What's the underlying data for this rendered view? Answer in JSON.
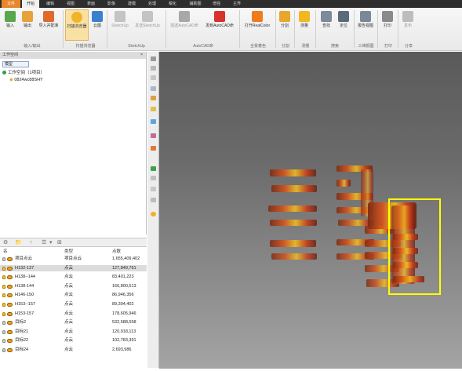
{
  "colors": {
    "menubar_bg": "#2e2e2e",
    "file_tab": "#e9852a",
    "active_bulb": "#f4c430",
    "inactive_bulb": "#cccccc",
    "highlight_box": "#ffff00"
  },
  "menu": {
    "file_tab": "文件",
    "tabs": [
      "开始",
      "编辑",
      "视图",
      "表面",
      "影像",
      "建模",
      "处理",
      "稿化",
      "辅助图",
      "增强",
      "主界"
    ],
    "active_tab": "开始"
  },
  "ribbon": {
    "buttons": [
      {
        "label": "输入",
        "icon": "import-icon"
      },
      {
        "label": "输出",
        "icon": "export-icon"
      },
      {
        "label": "导入并配准",
        "icon": "import-register-icon"
      },
      {
        "label": "扫描浏览器",
        "icon": "scan-browser-icon"
      },
      {
        "label": "云图",
        "icon": "cloud-icon"
      },
      {
        "label": "SketchUp",
        "icon": "sketchup-icon"
      },
      {
        "label": "发送SketchUp",
        "icon": "send-sketchup-icon"
      },
      {
        "label": "插送AutoCAD命",
        "icon": "cad-icon"
      },
      {
        "label": "发到AutoCAD命",
        "icon": "send-cad-icon"
      },
      {
        "label": "打开RealColor",
        "icon": "realcolor-icon"
      },
      {
        "label": "分割",
        "icon": "segment-icon"
      },
      {
        "label": "测量",
        "icon": "measure-icon"
      },
      {
        "label": "查找",
        "icon": "find-icon"
      },
      {
        "label": "定位",
        "icon": "locate-icon"
      },
      {
        "label": "报告视图",
        "icon": "report-view-icon"
      },
      {
        "label": "打印",
        "icon": "print-icon"
      },
      {
        "label": "发布",
        "icon": "publish-icon"
      }
    ],
    "groups": [
      "输入/输出",
      "扫描浏览器",
      "SketchUp",
      "AutoCAD命",
      "全景着色",
      "分割",
      "测量",
      "搜索",
      "三维报图",
      "打印",
      "分享"
    ]
  },
  "workspace": {
    "panel_title": "工作空间",
    "pin": "×",
    "tab": "模型",
    "root": "工作空间（1项目）",
    "child": "0824wc88SHY"
  },
  "prop_toolbar": {
    "icons": [
      "settings-icon",
      "folder-icon",
      "up-arrow-icon",
      "filter-icon",
      "dropdown-icon",
      "view-icon"
    ],
    "glyphs": [
      "⚙",
      "📁",
      "↑",
      "☰",
      "▾",
      "⊞"
    ]
  },
  "table": {
    "headers": [
      "名",
      "类型",
      "点数"
    ],
    "rows": [
      {
        "name": "项目点云",
        "type": "项目点云",
        "points": "1,655,409,402",
        "selected": false,
        "active": false
      },
      {
        "name": "H132-137",
        "type": "点云",
        "points": "127,849,761",
        "selected": true,
        "active": true
      },
      {
        "name": "H138--144",
        "type": "点云",
        "points": "83,401,223",
        "selected": false,
        "active": true
      },
      {
        "name": "H138-144",
        "type": "点云",
        "points": "166,800,513",
        "selected": false,
        "active": true
      },
      {
        "name": "H146-150",
        "type": "点云",
        "points": "86,946,356",
        "selected": false,
        "active": true
      },
      {
        "name": "H153--157",
        "type": "点云",
        "points": "89,304,402",
        "selected": false,
        "active": true
      },
      {
        "name": "H153-157",
        "type": "点云",
        "points": "178,605,946",
        "selected": false,
        "active": true
      },
      {
        "name": "目标2",
        "type": "点云",
        "points": "532,588,558",
        "selected": false,
        "active": false
      },
      {
        "name": "目标21",
        "type": "点云",
        "points": "120,918,113",
        "selected": false,
        "active": false
      },
      {
        "name": "目标22",
        "type": "点云",
        "points": "102,783,391",
        "selected": false,
        "active": false
      },
      {
        "name": "目标24",
        "type": "点云",
        "points": "2,693,986",
        "selected": false,
        "active": false
      }
    ]
  }
}
